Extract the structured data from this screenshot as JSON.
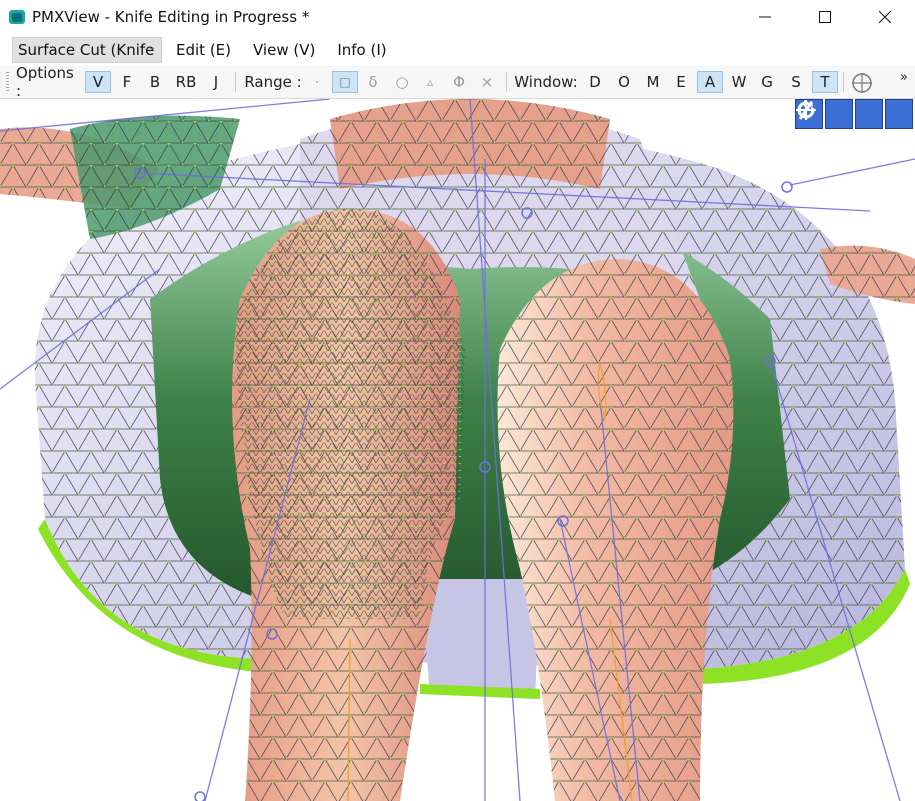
{
  "window": {
    "title": "PMXView  - Knife Editing in Progress *"
  },
  "menubar": {
    "mode": "Surface Cut (Knife",
    "items": [
      "Edit (E)",
      "View (V)",
      "Info (I)"
    ]
  },
  "toolbar": {
    "options_label": "Options :",
    "options": [
      "V",
      "F",
      "B",
      "RB",
      "J"
    ],
    "range_label": "Range :",
    "range_icons": [
      "dot-icon",
      "square-select-icon",
      "delta-icon",
      "circle-icon",
      "triangle-icon",
      "phi-icon",
      "cross-icon"
    ],
    "range_glyphs": [
      "·",
      "□",
      "δ",
      "○",
      "▵",
      "Φ",
      "×"
    ],
    "window_label": "Window:",
    "window_items": [
      "D",
      "O",
      "M",
      "E",
      "A",
      "W",
      "G",
      "S",
      "T"
    ],
    "overflow": "»"
  },
  "viewport_tools": [
    "move-xyz-icon",
    "move-plane-icon",
    "move-axis-icon",
    "rotate-icon"
  ],
  "colors": {
    "accent": "#cde4f7",
    "mesh_wire": "#3a3a4a",
    "vertex": "#8bdc2c",
    "skirt_green": "#2e6b3a",
    "skin": "#e8a48f",
    "lavender": "#c6c4e3",
    "bones": "#6d6fe0"
  }
}
